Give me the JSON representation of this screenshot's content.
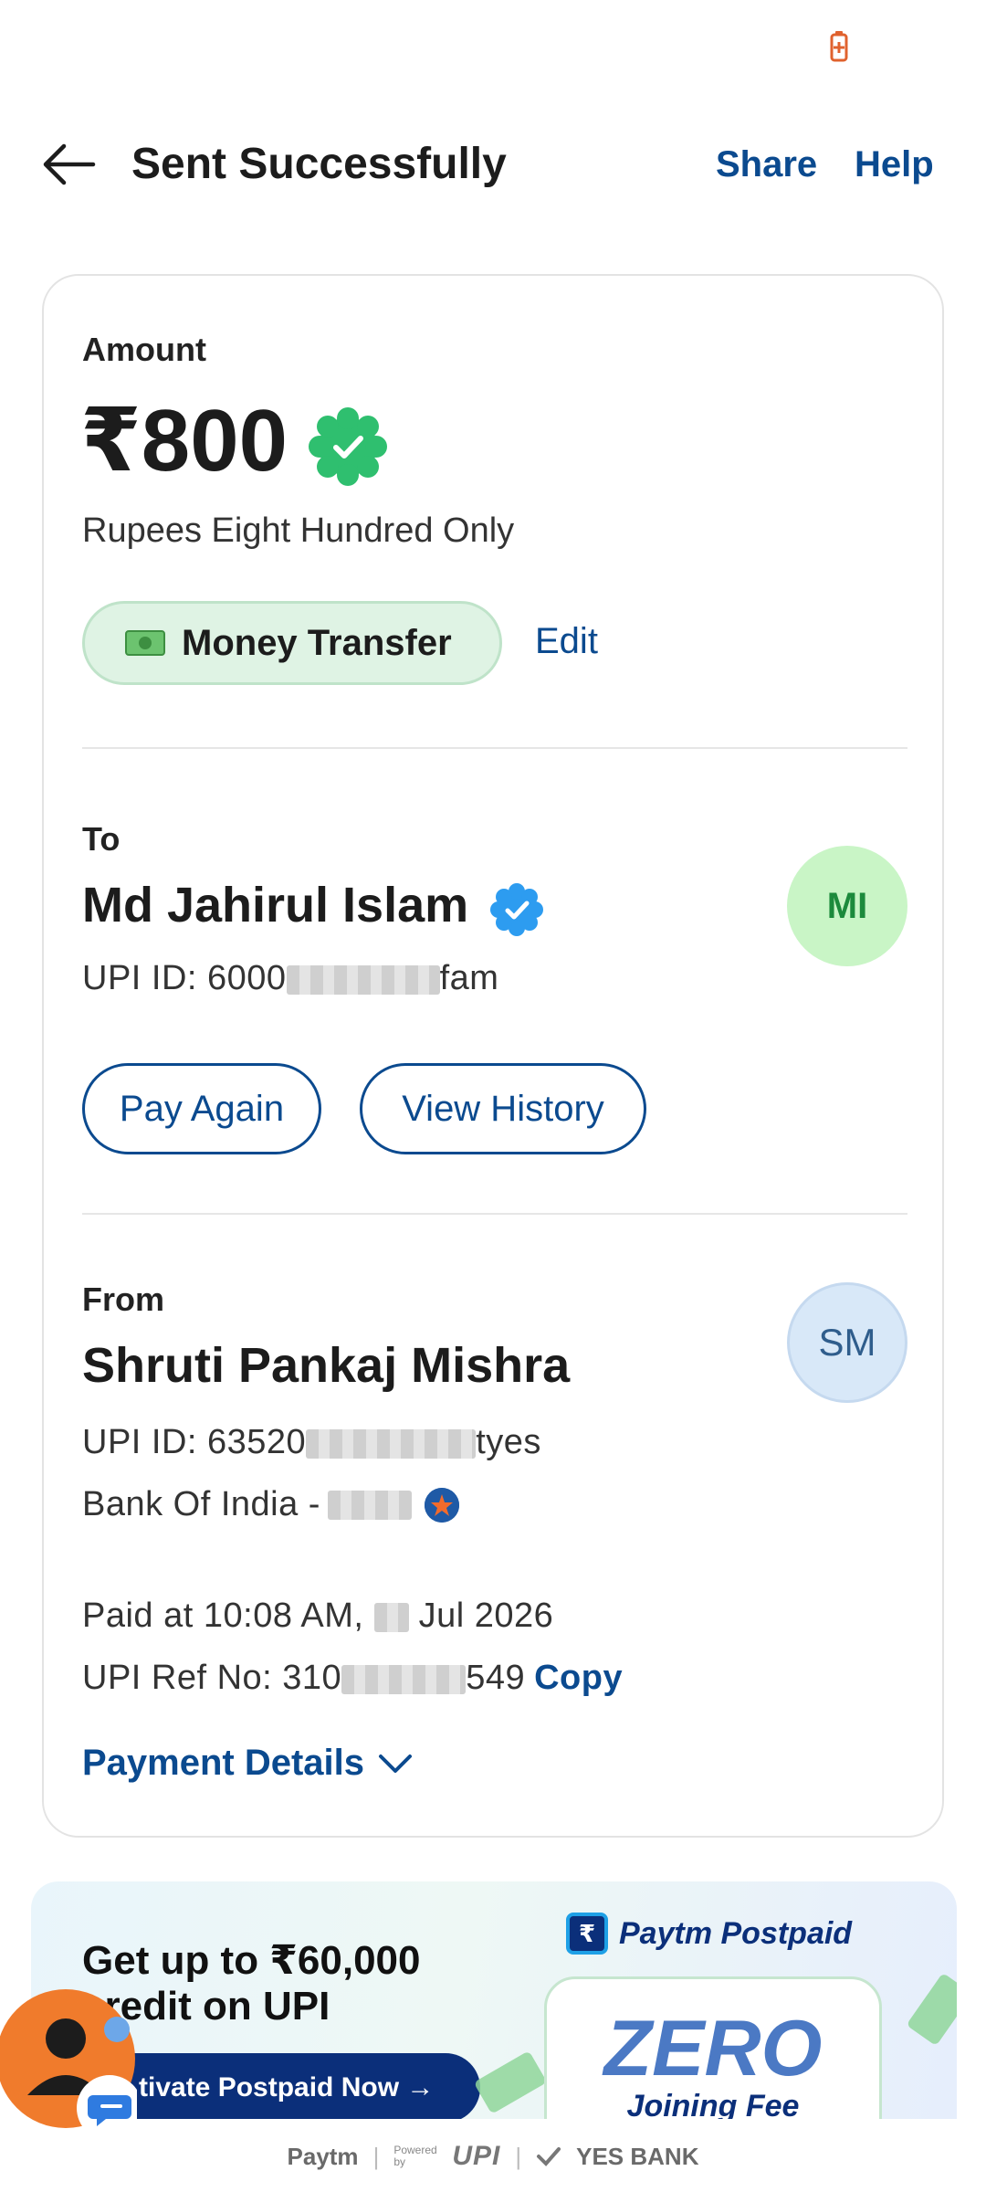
{
  "header": {
    "title": "Sent Successfully",
    "share_label": "Share",
    "help_label": "Help"
  },
  "amount": {
    "label": "Amount",
    "value": "₹800",
    "in_words": "Rupees Eight Hundred Only",
    "category": "Money Transfer",
    "edit_label": "Edit"
  },
  "to": {
    "label": "To",
    "name": "Md Jahirul Islam",
    "initials": "MI",
    "upi_prefix": "UPI ID: 6000",
    "upi_suffix": "fam",
    "pay_again_label": "Pay Again",
    "view_history_label": "View History"
  },
  "from": {
    "label": "From",
    "name": "Shruti Pankaj Mishra",
    "initials": "SM",
    "upi_prefix": "UPI ID: 63520",
    "upi_suffix": "tyes",
    "bank_prefix": "Bank Of India - "
  },
  "transaction": {
    "paid_at_prefix": "Paid at 10:08 AM, ",
    "paid_at_suffix": " Jul 2026",
    "ref_prefix": "UPI Ref No: 310",
    "ref_suffix": "549",
    "copy_label": "Copy",
    "payment_details_label": "Payment Details"
  },
  "promo": {
    "headline": "Get up to ₹60,000 credit on UPI",
    "cta": "tivate Postpaid Now →",
    "brand": "Paytm Postpaid",
    "zero": "ZERO",
    "joining_fee": "Joining Fee"
  },
  "footer": {
    "paytm": "Paytm",
    "powered_by": "Powered by",
    "upi": "UPI",
    "bank": "YES BANK"
  },
  "colors": {
    "accent": "#0b4a8f",
    "success": "#2fbf6f",
    "chip_bg": "#dff3e4"
  }
}
